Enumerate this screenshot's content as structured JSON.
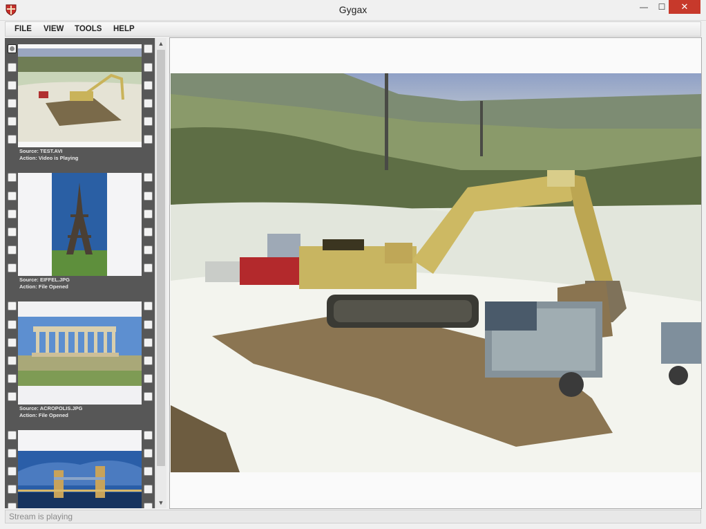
{
  "window": {
    "title": "Gygax",
    "minimize_glyph": "—",
    "maximize_glyph": "☐",
    "close_glyph": "✕"
  },
  "menu": {
    "items": [
      "FILE",
      "VIEW",
      "TOOLS",
      "HELP"
    ]
  },
  "filmstrip": {
    "frames": [
      {
        "source": "Source: TEST.AVI",
        "action": "Action: Video is Playing",
        "subject": "excavator-video-thumbnail",
        "selected": true
      },
      {
        "source": "Source: EIFFEL.JPG",
        "action": "Action: File Opened",
        "subject": "eiffel-tower-thumbnail",
        "selected": false
      },
      {
        "source": "Source: ACROPOLIS.JPG",
        "action": "Action: File Opened",
        "subject": "acropolis-thumbnail",
        "selected": false
      },
      {
        "source": "",
        "action": "",
        "subject": "tower-bridge-thumbnail",
        "selected": false
      }
    ],
    "scroll_up_glyph": "▲",
    "scroll_down_glyph": "▼"
  },
  "viewer": {
    "content": "excavator-video-frame"
  },
  "status": {
    "text": "Stream is playing"
  },
  "colors": {
    "close_button": "#c7392b",
    "film_background": "#575757",
    "caption_text": "#eaeaea",
    "status_text": "#8a8a8a"
  }
}
